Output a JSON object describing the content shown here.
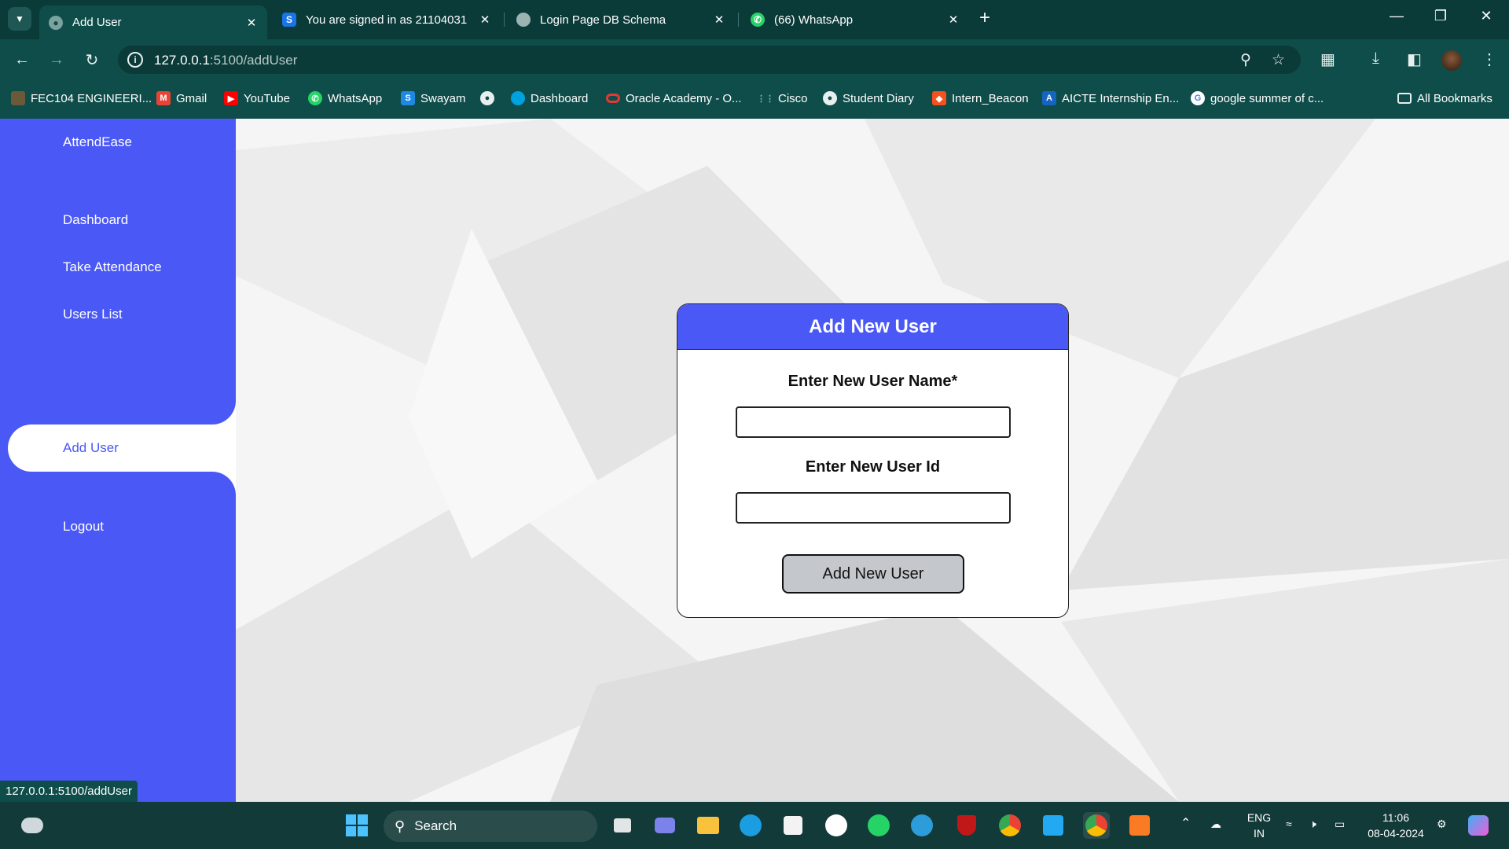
{
  "browser": {
    "tabs": [
      {
        "label": "Add User",
        "active": true
      },
      {
        "label": "You are signed in as 21104031",
        "favicon_text": "S"
      },
      {
        "label": "Login Page DB Schema"
      },
      {
        "label": "(66) WhatsApp"
      }
    ],
    "url_host": "127.0.0.1",
    "url_path": ":5100/addUser",
    "bookmarks": [
      "FEC104 ENGINEERI...",
      "Gmail",
      "YouTube",
      "WhatsApp",
      "Swayam",
      "",
      "Dashboard",
      "Oracle Academy - O...",
      "Cisco",
      "Student Diary",
      "Intern_Beacon",
      "AICTE Internship En...",
      "google summer of c..."
    ],
    "all_bookmarks": "All Bookmarks",
    "status_url": "127.0.0.1:5100/addUser"
  },
  "sidebar": {
    "brand": "AttendEase",
    "items": [
      {
        "label": "Dashboard"
      },
      {
        "label": "Take Attendance"
      },
      {
        "label": "Users List"
      },
      {
        "label": "Add User",
        "active": true
      },
      {
        "label": "Logout"
      }
    ]
  },
  "form": {
    "title": "Add New User",
    "name_label": "Enter New User Name*",
    "name_value": "",
    "id_label": "Enter New User Id",
    "id_value": "",
    "submit_label": "Add New User"
  },
  "taskbar": {
    "search_placeholder": "Search",
    "lang_line1": "ENG",
    "lang_line2": "IN",
    "time": "11:06",
    "date": "08-04-2024"
  },
  "colors": {
    "accent": "#4a58f5",
    "browser_frame": "#0f4d4a",
    "button_gray": "#c4c8cc"
  }
}
